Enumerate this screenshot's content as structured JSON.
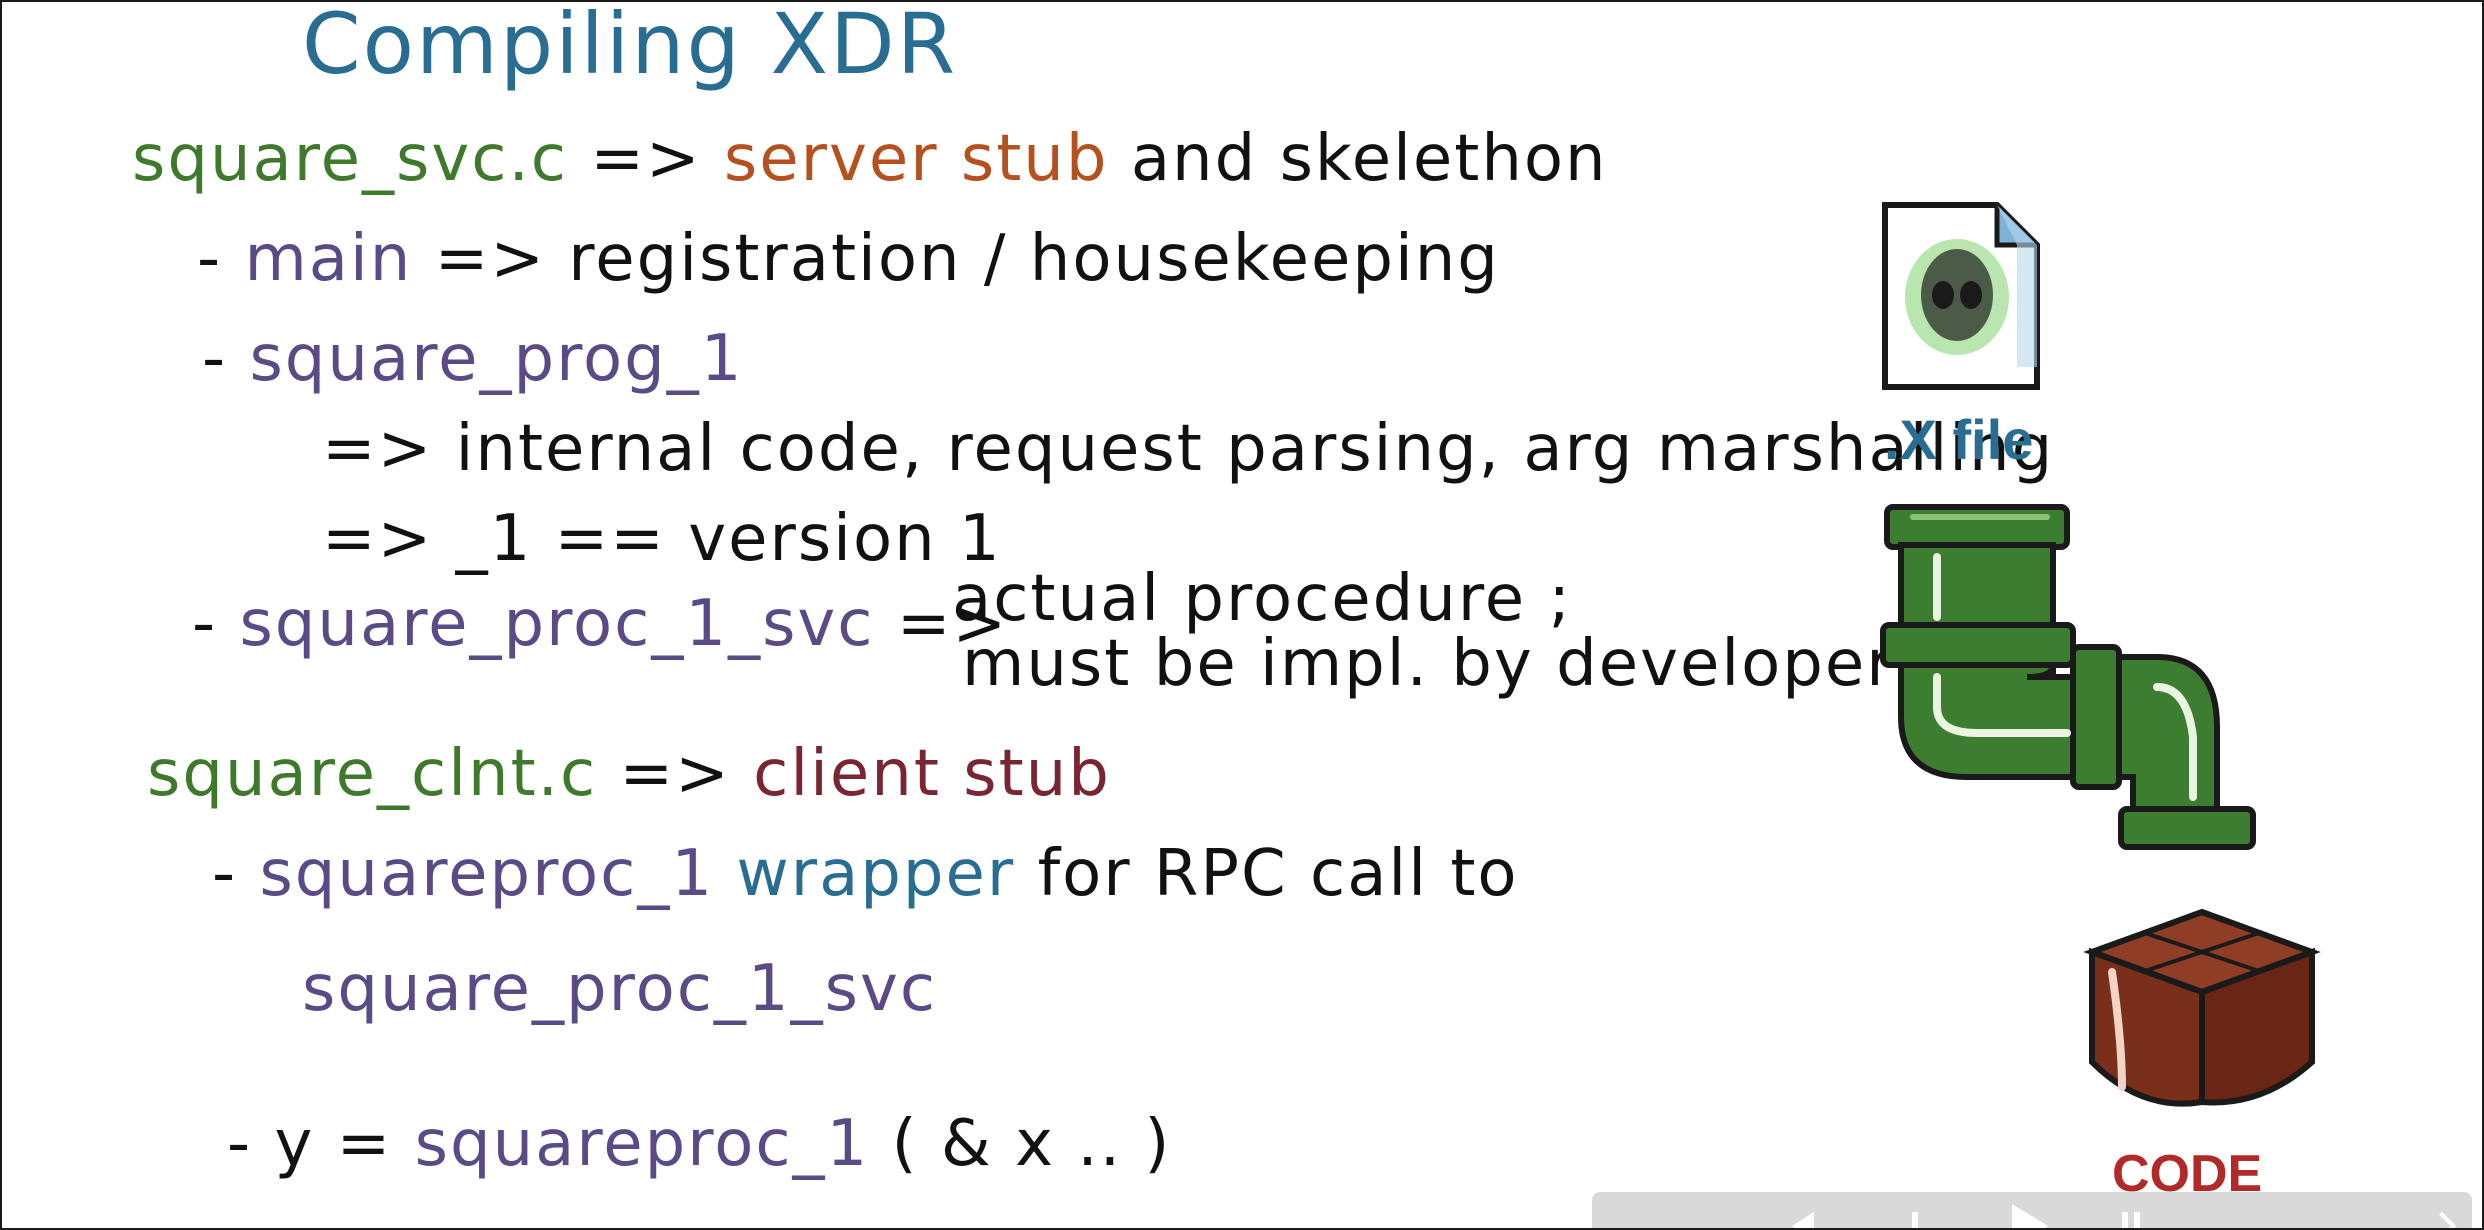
{
  "slide": {
    "title": "Compiling XDR",
    "server": {
      "file": "square_svc.c",
      "arrow": "=>",
      "desc_highlight": "server stub",
      "desc_rest": "and skelethon",
      "items": [
        {
          "bullet": "-",
          "name": "main",
          "arrow": "=>",
          "desc": "registration / housekeeping"
        },
        {
          "bullet": "-",
          "name": "square_prog_1",
          "sub": [
            "=> internal code, request parsing, arg marshalling",
            "=> _1 == version 1"
          ]
        },
        {
          "bullet": "-",
          "name": "square_proc_1_svc",
          "arrow": "=>",
          "desc_line1": "actual procedure ;",
          "desc_line2": "must be impl. by developer"
        }
      ]
    },
    "client": {
      "file": "square_clnt.c",
      "arrow": "=>",
      "desc": "client stub",
      "items": [
        {
          "bullet": "-",
          "name": "squareproc_1",
          "highlight": "wrapper",
          "rest": "for RPC call to",
          "line2": "square_proc_1_svc"
        },
        {
          "bullet": "-",
          "lhs": "y",
          "eq": "=",
          "call": "squareproc_1",
          "args": "( & x .. )"
        }
      ]
    }
  },
  "illustrations": {
    "xfile_label": ".X file",
    "code_label": "CODE",
    "icons": [
      "alien-file-icon",
      "pipe-icon",
      "package-icon"
    ]
  },
  "player": {
    "controls": [
      "prev-icon",
      "play-icon",
      "next-icon",
      "settings-icon"
    ]
  },
  "colors": {
    "title": "#2a6d93",
    "file_green": "#3f7a2c",
    "name_purple": "#5a4a86",
    "server_stub_orange": "#b5501f",
    "client_stub_maroon": "#7a2632",
    "xfile_blue": "#2a6d93",
    "code_red": "#b02a2a",
    "pipe_green": "#3d7d2f"
  }
}
